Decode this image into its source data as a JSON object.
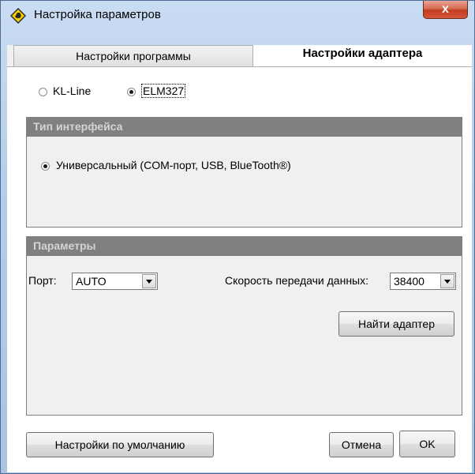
{
  "window": {
    "title": "Настройка параметров",
    "close_label": "x"
  },
  "tabs": [
    {
      "label": "Настройки программы"
    },
    {
      "label": "Настройки адаптера"
    }
  ],
  "protocol": {
    "options": [
      {
        "label": "KL-Line",
        "selected": false
      },
      {
        "label": "ELM327",
        "selected": true
      }
    ]
  },
  "interface_group": {
    "title": "Тип интерфейса",
    "option_label": "Универсальный (COM-порт, USB, BlueTooth®)"
  },
  "params_group": {
    "title": "Параметры",
    "port_label": "Порт:",
    "port_value": "AUTO",
    "speed_label": "Скорость передачи данных:",
    "speed_value": "38400",
    "find_label": "Найти адаптер"
  },
  "footer": {
    "defaults_label": "Настройки по умолчанию",
    "cancel_label": "Отмена",
    "ok_label": "OK"
  },
  "colors": {
    "group_header": "#808080",
    "close_button": "#c23b1f",
    "title_gradient": "#b5cde9"
  }
}
